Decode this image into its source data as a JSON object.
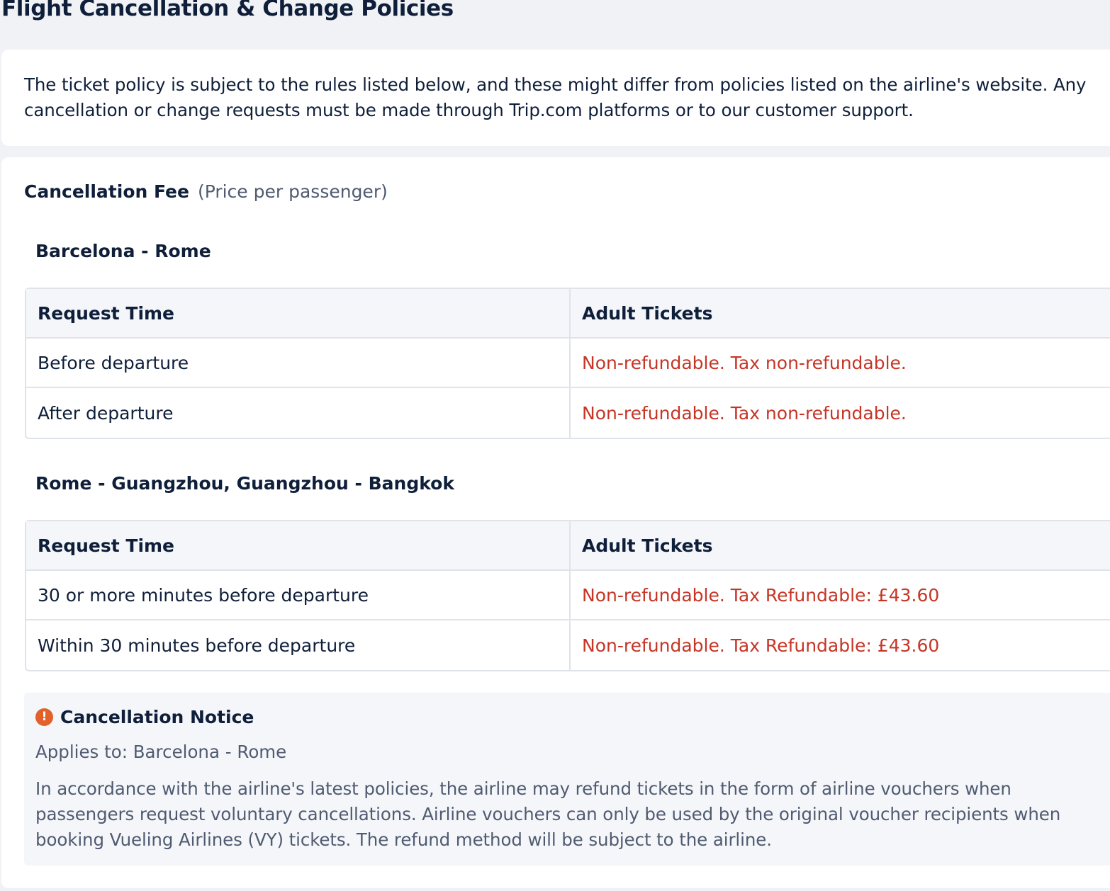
{
  "page_title": "Flight Cancellation & Change Policies",
  "intro_text": "The ticket policy is subject to the rules listed below, and these might differ from policies listed on the airline's website. Any cancellation or change requests must be made through Trip.com platforms or to our customer support.",
  "cancellation_fee": {
    "heading": "Cancellation Fee",
    "subheading": "(Price per passenger)"
  },
  "routes": [
    {
      "title": "Barcelona - Rome",
      "columns": [
        "Request Time",
        "Adult Tickets"
      ],
      "rows": [
        {
          "request_time": "Before departure",
          "adult_tickets": "Non-refundable. Tax non-refundable."
        },
        {
          "request_time": "After departure",
          "adult_tickets": "Non-refundable. Tax non-refundable."
        }
      ]
    },
    {
      "title": "Rome - Guangzhou, Guangzhou - Bangkok",
      "columns": [
        "Request Time",
        "Adult Tickets"
      ],
      "rows": [
        {
          "request_time": "30 or more minutes before departure",
          "adult_tickets": "Non-refundable. Tax Refundable: £43.60"
        },
        {
          "request_time": "Within 30 minutes before departure",
          "adult_tickets": "Non-refundable. Tax Refundable: £43.60"
        }
      ]
    }
  ],
  "notice": {
    "icon": "exclamation-circle-icon",
    "icon_glyph": "!",
    "title": "Cancellation Notice",
    "applies_to": "Applies to: Barcelona - Rome",
    "body": "In accordance with the airline's latest policies, the airline may refund tickets in the form of airline vouchers when passengers request voluntary cancellations. Airline vouchers can only be used by the original voucher recipients when booking Vueling Airlines (VY) tickets. The refund method will be subject to the airline."
  },
  "colors": {
    "text_primary": "#0f1f3a",
    "text_secondary": "#505b70",
    "fee_text": "#c63526",
    "warning_icon": "#e2602a",
    "background": "#f0f2f6"
  }
}
